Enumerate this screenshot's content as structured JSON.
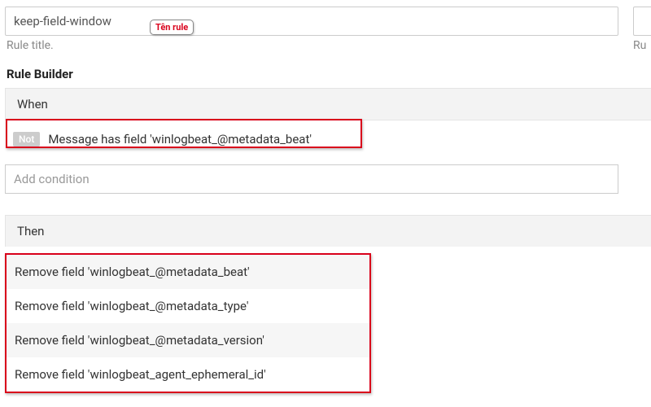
{
  "title": {
    "input_value": "keep-field-window",
    "helper": "Rule title.",
    "callout": "Tên rule",
    "right_helper_prefix": "Ru"
  },
  "section": {
    "builder_title": "Rule Builder"
  },
  "when": {
    "header": "When",
    "not_label": "Not",
    "condition_text": "Message has field 'winlogbeat_@metadata_beat'",
    "add_condition_placeholder": "Add condition"
  },
  "then": {
    "header": "Then",
    "actions": [
      "Remove field 'winlogbeat_@metadata_beat'",
      "Remove field 'winlogbeat_@metadata_type'",
      "Remove field 'winlogbeat_@metadata_version'",
      "Remove field 'winlogbeat_agent_ephemeral_id'"
    ]
  }
}
